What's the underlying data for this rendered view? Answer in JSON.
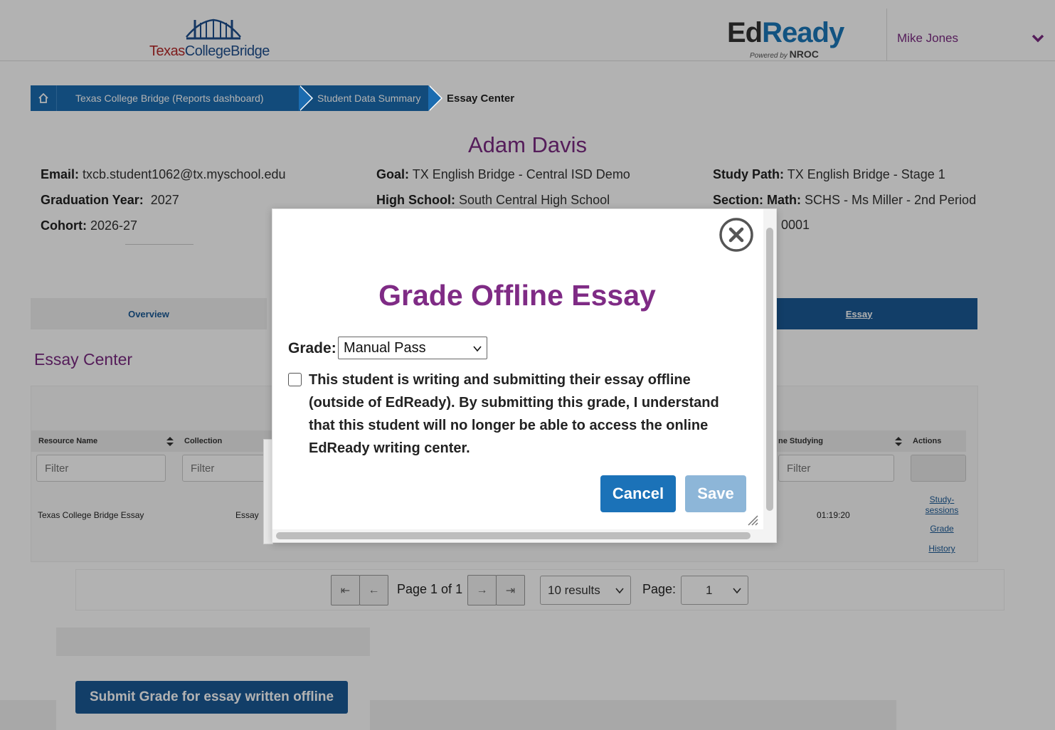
{
  "header": {
    "logo_left_part1": "Texas",
    "logo_left_part2": "CollegeBridge",
    "logo_right_ed": "Ed",
    "logo_right_ready": "Ready",
    "logo_right_powered": "Powered by",
    "logo_right_nroc": "NROC",
    "user_name": "Mike Jones"
  },
  "breadcrumb": {
    "items": [
      {
        "label": "Texas College Bridge (Reports dashboard)"
      },
      {
        "label": "Student Data Summary"
      }
    ],
    "current": "Essay Center"
  },
  "student": {
    "name": "Adam Davis",
    "email_label": "Email:",
    "email": "txcb.student1062@tx.myschool.edu",
    "grad_year_label": "Graduation Year:",
    "grad_year": "2027",
    "cohort_label": "Cohort:",
    "cohort": "2026-27",
    "goal_label": "Goal:",
    "goal": "TX English Bridge - Central ISD Demo",
    "high_school_label": "High School:",
    "high_school": "South Central High School",
    "study_path_label": "Study Path:",
    "study_path": "TX English Bridge - Stage 1",
    "section_label": "Section: Math:",
    "section": "SCHS - Ms Miller - 2nd Period",
    "partial_id": "0001"
  },
  "tabs": {
    "overview": "Overview",
    "essay": "Essay"
  },
  "essay_center": {
    "title": "Essay Center",
    "columns": {
      "resource_name": "Resource Name",
      "collection": "Collection",
      "time_studying_partial": "ne Studying",
      "actions": "Actions"
    },
    "filter_placeholder": "Filter",
    "rows": [
      {
        "resource_name": "Texas College Bridge Essay",
        "collection": "Essay",
        "time": "01:19:20",
        "actions": [
          "Study-sessions",
          "Grade",
          "History"
        ]
      }
    ]
  },
  "pagination": {
    "page_text": "Page 1 of 1",
    "results": "10 results",
    "page_label": "Page:",
    "page_value": "1"
  },
  "submit_button": "Submit Grade for essay written offline",
  "modal": {
    "title": "Grade Offline Essay",
    "grade_label": "Grade:",
    "grade_value": "Manual Pass",
    "message": "This student is writing and submitting their essay offline (outside of EdReady). By submitting this grade, I understand that this student will no longer be able to access the online EdReady writing center.",
    "cancel": "Cancel",
    "save": "Save"
  },
  "colors": {
    "brand_purple": "#7a2a82",
    "brand_blue": "#1b5a96",
    "button_blue": "#1b72b8",
    "disabled_blue": "#8db6d8"
  }
}
